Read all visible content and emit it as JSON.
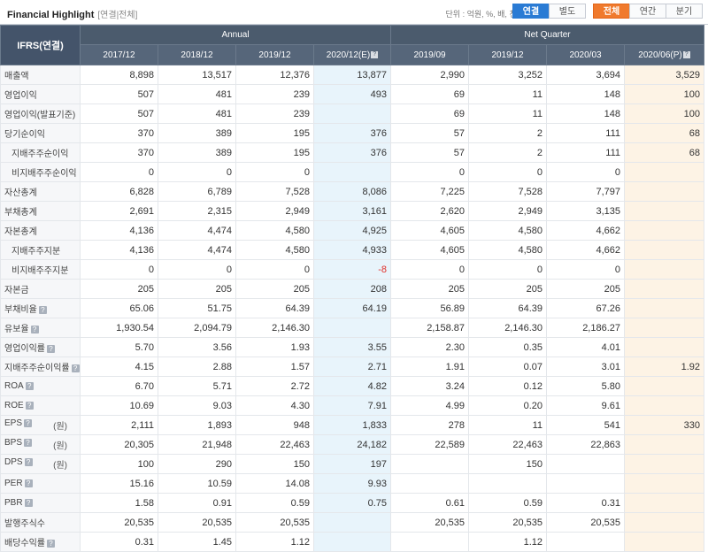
{
  "header": {
    "title": "Financial Highlight",
    "subtitle": "[연결|전체]",
    "unit": "단위 : 억원, %, 배, 천주",
    "toggle1": [
      "연결",
      "별도"
    ],
    "toggle2": [
      "전체",
      "연간",
      "분기"
    ]
  },
  "table": {
    "corner": "IFRS(연결)",
    "groups": [
      "Annual",
      "Net Quarter"
    ],
    "periods": [
      "2017/12",
      "2018/12",
      "2019/12",
      "2020/12(E)",
      "2019/09",
      "2019/12",
      "2020/03",
      "2020/06(P)"
    ],
    "rows": [
      {
        "label": "매출액",
        "unit": "",
        "q": false,
        "indent": false,
        "values": [
          "8,898",
          "13,517",
          "12,376",
          "13,877",
          "2,990",
          "3,252",
          "3,694",
          "3,529"
        ]
      },
      {
        "label": "영업이익",
        "unit": "",
        "q": false,
        "indent": false,
        "values": [
          "507",
          "481",
          "239",
          "493",
          "69",
          "11",
          "148",
          "100"
        ]
      },
      {
        "label": "영업이익(발표기준)",
        "unit": "",
        "q": false,
        "indent": false,
        "values": [
          "507",
          "481",
          "239",
          "",
          "69",
          "11",
          "148",
          "100"
        ]
      },
      {
        "label": "당기순이익",
        "unit": "",
        "q": false,
        "indent": false,
        "values": [
          "370",
          "389",
          "195",
          "376",
          "57",
          "2",
          "111",
          "68"
        ]
      },
      {
        "label": "지배주주순이익",
        "unit": "",
        "q": false,
        "indent": true,
        "values": [
          "370",
          "389",
          "195",
          "376",
          "57",
          "2",
          "111",
          "68"
        ]
      },
      {
        "label": "비지배주주순이익",
        "unit": "",
        "q": false,
        "indent": true,
        "values": [
          "0",
          "0",
          "0",
          "",
          "0",
          "0",
          "0",
          ""
        ]
      },
      {
        "label": "자산총계",
        "unit": "",
        "q": false,
        "indent": false,
        "values": [
          "6,828",
          "6,789",
          "7,528",
          "8,086",
          "7,225",
          "7,528",
          "7,797",
          ""
        ]
      },
      {
        "label": "부채총계",
        "unit": "",
        "q": false,
        "indent": false,
        "values": [
          "2,691",
          "2,315",
          "2,949",
          "3,161",
          "2,620",
          "2,949",
          "3,135",
          ""
        ]
      },
      {
        "label": "자본총계",
        "unit": "",
        "q": false,
        "indent": false,
        "values": [
          "4,136",
          "4,474",
          "4,580",
          "4,925",
          "4,605",
          "4,580",
          "4,662",
          ""
        ]
      },
      {
        "label": "지배주주지분",
        "unit": "",
        "q": false,
        "indent": true,
        "values": [
          "4,136",
          "4,474",
          "4,580",
          "4,933",
          "4,605",
          "4,580",
          "4,662",
          ""
        ]
      },
      {
        "label": "비지배주주지분",
        "unit": "",
        "q": false,
        "indent": true,
        "values": [
          "0",
          "0",
          "0",
          "-8",
          "0",
          "0",
          "0",
          ""
        ]
      },
      {
        "label": "자본금",
        "unit": "",
        "q": false,
        "indent": false,
        "values": [
          "205",
          "205",
          "205",
          "208",
          "205",
          "205",
          "205",
          ""
        ]
      },
      {
        "label": "부채비율",
        "unit": "",
        "q": true,
        "indent": false,
        "values": [
          "65.06",
          "51.75",
          "64.39",
          "64.19",
          "56.89",
          "64.39",
          "67.26",
          ""
        ]
      },
      {
        "label": "유보율",
        "unit": "",
        "q": true,
        "indent": false,
        "values": [
          "1,930.54",
          "2,094.79",
          "2,146.30",
          "",
          "2,158.87",
          "2,146.30",
          "2,186.27",
          ""
        ]
      },
      {
        "label": "영업이익률",
        "unit": "",
        "q": true,
        "indent": false,
        "values": [
          "5.70",
          "3.56",
          "1.93",
          "3.55",
          "2.30",
          "0.35",
          "4.01",
          ""
        ]
      },
      {
        "label": "지배주주순이익률",
        "unit": "",
        "q": true,
        "indent": false,
        "values": [
          "4.15",
          "2.88",
          "1.57",
          "2.71",
          "1.91",
          "0.07",
          "3.01",
          "1.92"
        ]
      },
      {
        "label": "ROA",
        "unit": "",
        "q": true,
        "indent": false,
        "values": [
          "6.70",
          "5.71",
          "2.72",
          "4.82",
          "3.24",
          "0.12",
          "5.80",
          ""
        ]
      },
      {
        "label": "ROE",
        "unit": "",
        "q": true,
        "indent": false,
        "values": [
          "10.69",
          "9.03",
          "4.30",
          "7.91",
          "4.99",
          "0.20",
          "9.61",
          ""
        ]
      },
      {
        "label": "EPS",
        "unit": "(원)",
        "q": true,
        "indent": false,
        "values": [
          "2,111",
          "1,893",
          "948",
          "1,833",
          "278",
          "11",
          "541",
          "330"
        ]
      },
      {
        "label": "BPS",
        "unit": "(원)",
        "q": true,
        "indent": false,
        "values": [
          "20,305",
          "21,948",
          "22,463",
          "24,182",
          "22,589",
          "22,463",
          "22,863",
          ""
        ]
      },
      {
        "label": "DPS",
        "unit": "(원)",
        "q": true,
        "indent": false,
        "values": [
          "100",
          "290",
          "150",
          "197",
          "",
          "150",
          "",
          ""
        ]
      },
      {
        "label": "PER",
        "unit": "",
        "q": true,
        "indent": false,
        "values": [
          "15.16",
          "10.59",
          "14.08",
          "9.93",
          "",
          "",
          "",
          ""
        ]
      },
      {
        "label": "PBR",
        "unit": "",
        "q": true,
        "indent": false,
        "values": [
          "1.58",
          "0.91",
          "0.59",
          "0.75",
          "0.61",
          "0.59",
          "0.31",
          ""
        ]
      },
      {
        "label": "발행주식수",
        "unit": "",
        "q": false,
        "indent": false,
        "values": [
          "20,535",
          "20,535",
          "20,535",
          "",
          "20,535",
          "20,535",
          "20,535",
          ""
        ]
      },
      {
        "label": "배당수익률",
        "unit": "",
        "q": true,
        "indent": false,
        "values": [
          "0.31",
          "1.45",
          "1.12",
          "",
          "",
          "1.12",
          "",
          ""
        ]
      }
    ]
  }
}
